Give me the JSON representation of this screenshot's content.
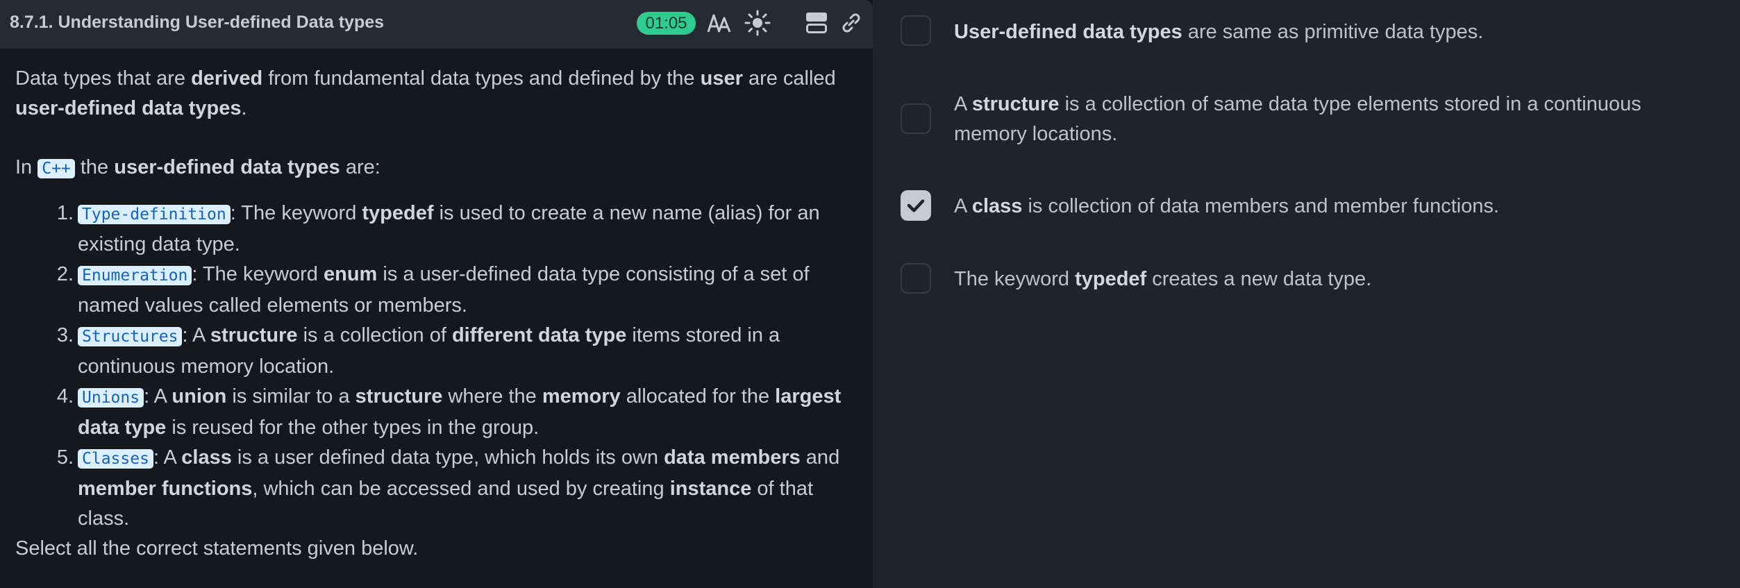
{
  "header": {
    "title": "8.7.1. Understanding User-defined Data types",
    "timer": "01:05",
    "icons": [
      "font-size-icon",
      "theme-sun-icon",
      "layout-icon",
      "link-icon"
    ]
  },
  "lesson": {
    "intro": {
      "t1": "Data types that are ",
      "b1": "derived",
      "t2": " from fundamental data types and defined by the ",
      "b2": "user",
      "t3": " are called ",
      "b3": "user-defined data types",
      "t4": "."
    },
    "lead": {
      "t1": "In ",
      "code": "C++",
      "t2": " the ",
      "b1": "user-defined data types",
      "t3": " are:"
    },
    "items": [
      {
        "num": "1.",
        "code": "Type-definition",
        "t1": ": The keyword ",
        "b1": "typedef",
        "t2": " is used to create a new name (alias) for an existing data type."
      },
      {
        "num": "2.",
        "code": "Enumeration",
        "t1": ": The keyword ",
        "b1": "enum",
        "t2": " is a user-defined data type consisting of a set of named values called elements or members."
      },
      {
        "num": "3.",
        "code": "Structures",
        "t1": ": A ",
        "b1": "structure",
        "t2": " is a collection of ",
        "b2": "different data type",
        "t3": " items stored in a continuous memory location."
      },
      {
        "num": "4.",
        "code": "Unions",
        "t1": ": A ",
        "b1": "union",
        "t2": " is similar to a ",
        "b2": "structure",
        "t3": " where the ",
        "b3": "memory",
        "t4": " allocated for the ",
        "b4": "largest data type",
        "t5": " is reused for the other types in the group."
      },
      {
        "num": "5.",
        "code": "Classes",
        "t1": ": A ",
        "b1": "class",
        "t2": " is a user defined data type, which holds its own ",
        "b2": "data members",
        "t3": " and ",
        "b3": "member functions",
        "t4": ", which can be accessed and used by creating ",
        "b4": "instance",
        "t5": " of that class."
      }
    ],
    "prompt": "Select all the correct statements given below."
  },
  "options": [
    {
      "checked": false,
      "b1": "User-defined data types",
      "t1": " are same as primitive data types."
    },
    {
      "checked": false,
      "t0": "A ",
      "b1": "structure",
      "t1": " is a collection of same data type elements stored in a continuous memory locations."
    },
    {
      "checked": true,
      "t0": "A ",
      "b1": "class",
      "t1": " is collection of data members and member functions."
    },
    {
      "checked": false,
      "t0": "The keyword ",
      "b1": "typedef",
      "t1": " creates a new data type."
    }
  ],
  "colors": {
    "timer_bg": "#2ecc8f",
    "code_bg": "#dcefff",
    "code_text": "#1663b8",
    "checked_bg": "#c7cbd1"
  }
}
